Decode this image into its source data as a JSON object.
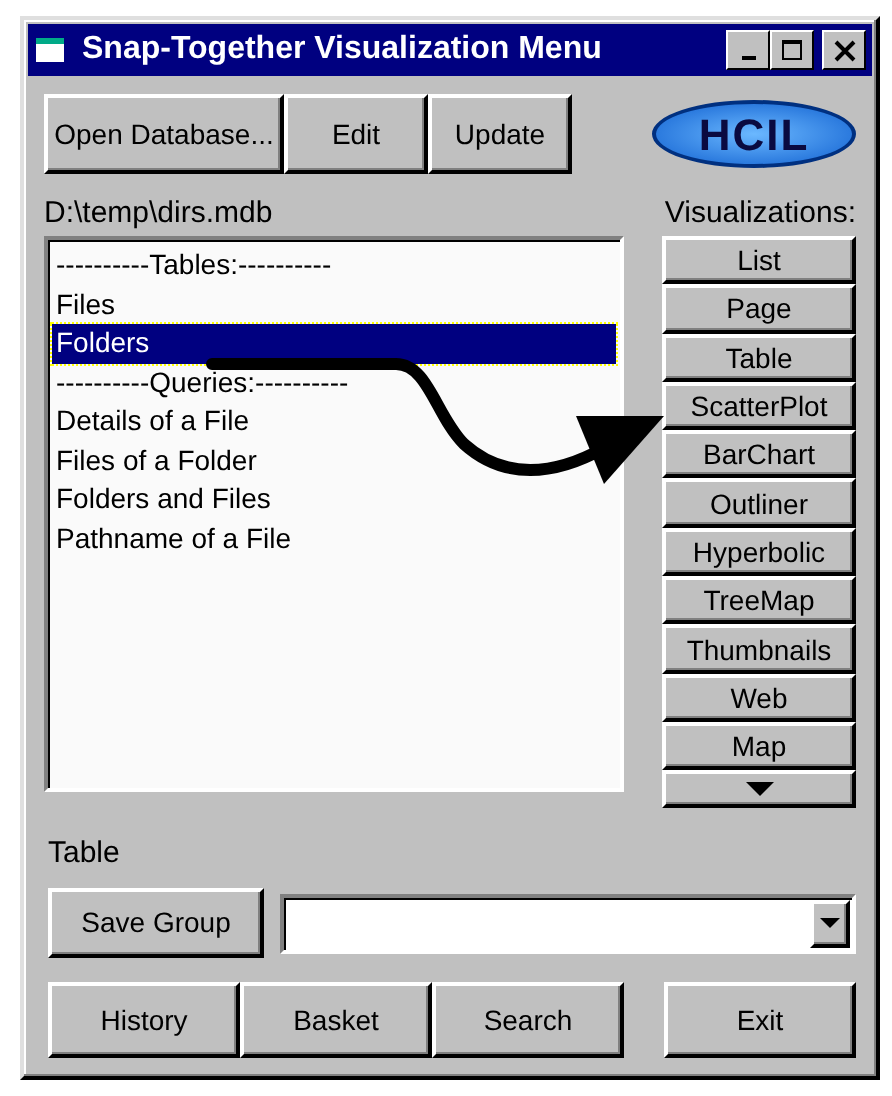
{
  "window": {
    "title": "Snap-Together Visualization Menu"
  },
  "toolbar": [
    "Open Database...",
    "Edit",
    "Update"
  ],
  "logo": "HCIL",
  "database_path": "D:\\temp\\dirs.mdb",
  "visualizations_label": "Visualizations:",
  "list": [
    {
      "label": "----------Tables:----------",
      "selected": false
    },
    {
      "label": "Files",
      "selected": false
    },
    {
      "label": "Folders",
      "selected": true
    },
    {
      "label": "----------Queries:----------",
      "selected": false
    },
    {
      "label": "Details of a File",
      "selected": false
    },
    {
      "label": "Files of a Folder",
      "selected": false
    },
    {
      "label": "Folders and Files",
      "selected": false
    },
    {
      "label": "Pathname of a File",
      "selected": false
    }
  ],
  "visualizations": [
    "List",
    "Page",
    "Table",
    "ScatterPlot",
    "BarChart",
    "Outliner",
    "Hyperbolic",
    "TreeMap",
    "Thumbnails",
    "Web",
    "Map"
  ],
  "status": "Table",
  "save_button": "Save Group",
  "bottom_buttons": [
    "History",
    "Basket",
    "Search"
  ],
  "exit_button": "Exit"
}
